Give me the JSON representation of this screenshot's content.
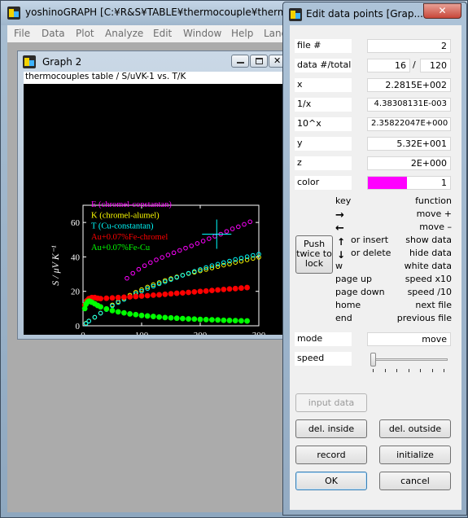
{
  "colors": {
    "color_swatch": "#ff00ff"
  },
  "main_window": {
    "title": "yoshinoGRAPH [C:¥R&S¥TABLE¥thermocouple¥thermo",
    "icon": "yoshinograph-app-icon",
    "menu": [
      "File",
      "Data",
      "Plot",
      "Analyze",
      "Edit",
      "Window",
      "Help",
      "Lang"
    ]
  },
  "graph_window": {
    "title": "Graph 2",
    "subtitle": "thermocouples table / S/uVK-1 vs. T/K",
    "buttons": [
      "minimize-icon",
      "restore-icon",
      "close-icon"
    ]
  },
  "chart_data": {
    "type": "scatter",
    "xlabel": "T / K",
    "ylabel": "S / μV K⁻¹",
    "xlim": [
      0,
      300
    ],
    "ylim": [
      0,
      70
    ],
    "xticks": [
      "0",
      "100",
      "200",
      "300"
    ],
    "yticks": [
      "0",
      "20",
      "40",
      "60"
    ],
    "legend_position": "top-left",
    "background": "#000000",
    "series": [
      {
        "name": "E (chromel-constantan)",
        "color": "#ff00ff",
        "marker": "open-circle",
        "x": [
          75,
          85,
          95,
          105,
          115,
          125,
          135,
          145,
          155,
          165,
          175,
          185,
          195,
          205,
          215,
          225,
          235,
          245,
          255,
          265,
          275,
          285
        ],
        "y": [
          27.6,
          30.5,
          32.8,
          34.9,
          36.7,
          38.3,
          39.7,
          41.1,
          42.4,
          43.8,
          45.1,
          46.4,
          47.8,
          49.2,
          50.6,
          52.0,
          53.2,
          54.8,
          56.3,
          57.5,
          58.9,
          60.4
        ]
      },
      {
        "name": "K (chromel-alumel)",
        "color": "#ffff00",
        "marker": "open-circle",
        "x": [
          5,
          10,
          20,
          30,
          40,
          50,
          60,
          70,
          80,
          90,
          100,
          110,
          120,
          130,
          140,
          150,
          160,
          170,
          180,
          190,
          200,
          210,
          220,
          230,
          240,
          250,
          260,
          270,
          280,
          290,
          300
        ],
        "y": [
          1.5,
          2.8,
          4.9,
          7.4,
          9.8,
          12.1,
          14.1,
          16.0,
          17.8,
          19.5,
          21.0,
          22.5,
          23.9,
          25.1,
          26.3,
          27.4,
          28.4,
          29.4,
          30.3,
          31.1,
          31.9,
          32.7,
          33.6,
          34.4,
          35.2,
          35.9,
          36.8,
          37.5,
          38.3,
          39.1,
          39.8
        ]
      },
      {
        "name": "T (Cu-constantan)",
        "color": "#00ffff",
        "marker": "open-circle",
        "x": [
          5,
          10,
          20,
          30,
          40,
          50,
          60,
          70,
          80,
          90,
          100,
          110,
          120,
          130,
          140,
          150,
          160,
          170,
          180,
          190,
          200,
          210,
          220,
          230,
          240,
          250,
          260,
          270,
          280,
          290,
          300
        ],
        "y": [
          1.3,
          2.7,
          5.0,
          7.3,
          9.4,
          11.6,
          13.5,
          15.3,
          17.0,
          18.6,
          20.1,
          21.6,
          23.0,
          24.4,
          25.6,
          26.9,
          28.1,
          29.3,
          30.5,
          31.6,
          32.7,
          33.8,
          34.9,
          35.8,
          36.7,
          37.6,
          38.5,
          39.3,
          40.1,
          40.9,
          41.6
        ]
      },
      {
        "name": "Au+0.07%Fe-chromel",
        "color": "#ff0000",
        "marker": "filled-circle",
        "x": [
          3,
          6,
          10,
          15,
          20,
          25,
          30,
          40,
          50,
          60,
          70,
          80,
          90,
          100,
          110,
          120,
          130,
          140,
          150,
          160,
          170,
          180,
          190,
          200,
          210,
          220,
          230,
          240,
          250,
          260,
          270,
          280
        ],
        "y": [
          12.0,
          14.5,
          15.8,
          16.4,
          16.4,
          16.0,
          15.8,
          16.0,
          16.2,
          16.4,
          16.6,
          16.8,
          17.0,
          17.3,
          17.5,
          17.8,
          18.0,
          18.3,
          18.6,
          18.9,
          19.1,
          19.4,
          19.7,
          20.0,
          20.2,
          20.5,
          20.8,
          21.1,
          21.4,
          21.6,
          21.9,
          22.2
        ]
      },
      {
        "name": "Au+0.07%Fe-Cu",
        "color": "#00ff00",
        "marker": "filled-circle",
        "x": [
          3,
          5,
          8,
          10,
          12,
          15,
          20,
          25,
          30,
          40,
          50,
          60,
          70,
          80,
          90,
          100,
          110,
          120,
          130,
          140,
          150,
          160,
          170,
          180,
          190,
          200,
          210,
          220,
          230,
          240,
          250,
          260,
          270,
          280
        ],
        "y": [
          10.0,
          12.5,
          13.9,
          14.3,
          14.2,
          13.7,
          12.8,
          11.8,
          11.0,
          9.8,
          8.8,
          8.1,
          7.5,
          6.9,
          6.5,
          6.0,
          5.7,
          5.4,
          5.1,
          4.8,
          4.6,
          4.4,
          4.2,
          4.0,
          3.9,
          3.7,
          3.6,
          3.5,
          3.4,
          3.2,
          3.1,
          3.0,
          2.9,
          2.8
        ]
      }
    ],
    "cursor": {
      "x": 228.15,
      "y": 53.2,
      "color": "#00ffff"
    }
  },
  "dialog": {
    "title": "Edit data points [Grap...",
    "close_icon": "close-icon",
    "fields": {
      "file": {
        "label": "file #",
        "value": "2"
      },
      "data_total": {
        "label": "data #/total",
        "index": "16",
        "separator": "/",
        "total": "120"
      },
      "x": {
        "label": "x",
        "value": "2.2815E+002"
      },
      "inv_x": {
        "label": "1/x",
        "value": "4.38308131E-003"
      },
      "pow_x": {
        "label": "10^x",
        "value": "2.35822047E+000"
      },
      "y": {
        "label": "y",
        "value": "5.32E+001"
      },
      "z": {
        "label": "z",
        "value": "2E+000"
      },
      "color": {
        "label": "color",
        "value": "1"
      }
    },
    "keys": {
      "header_key": "key",
      "header_function": "function",
      "move_plus": "move +",
      "move_minus": "move –",
      "or_insert": "or insert",
      "show_data": "show data",
      "or_delete": "or delete",
      "hide_data": "hide data",
      "w_key": "w",
      "white_data": "white data",
      "page_up": "page up",
      "speed_x10": "speed x10",
      "page_down": "page down",
      "speed_10": "speed /10",
      "home": "home",
      "next_file": "next file",
      "end": "end",
      "previous_file": "previous file"
    },
    "lock_button": "Push twice to lock",
    "mode": {
      "label": "mode",
      "value": "move"
    },
    "speed": {
      "label": "speed",
      "level": 0
    },
    "buttons": {
      "input_data": "input data",
      "del_inside": "del. inside",
      "del_outside": "del. outside",
      "record": "record",
      "initialize": "initialize",
      "ok": "OK",
      "cancel": "cancel"
    }
  }
}
